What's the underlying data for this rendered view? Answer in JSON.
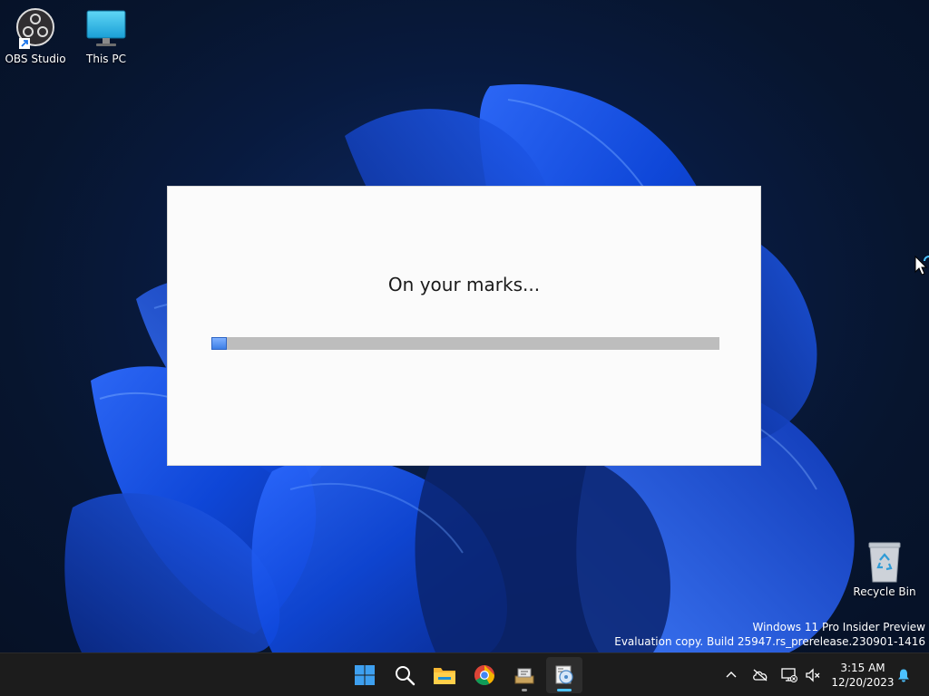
{
  "desktop": {
    "icons": [
      {
        "label": "OBS Studio",
        "icon": "obs-studio-icon"
      },
      {
        "label": "This PC",
        "icon": "monitor-icon"
      },
      {
        "label": "Recycle Bin",
        "icon": "recycle-bin-icon"
      }
    ],
    "watermark": {
      "line1": "Windows 11 Pro Insider Preview",
      "line2": "Evaluation copy. Build 25947.rs_prerelease.230901-1416"
    }
  },
  "dialog": {
    "message": "On your marks...",
    "progress": 0.03,
    "progress_color": "#3d7fe6",
    "track_color": "#bdbdbd"
  },
  "taskbar": {
    "apps": [
      {
        "icon": "windows-start-icon",
        "active": false
      },
      {
        "icon": "search-icon",
        "active": false
      },
      {
        "icon": "file-explorer-icon",
        "active": false
      },
      {
        "icon": "chrome-icon",
        "active": false
      },
      {
        "icon": "app-installer-icon",
        "active": false,
        "running": true
      },
      {
        "icon": "setup-app-icon",
        "active": true,
        "running": true
      }
    ],
    "tray_icons": [
      "chevron-up-icon",
      "cloud-offline-icon",
      "network-disconnected-icon",
      "speaker-muted-icon",
      "notification-bell-icon"
    ],
    "clock": {
      "time": "3:15 AM",
      "date": "12/20/2023"
    },
    "accent_color": "#4cc2ff"
  }
}
